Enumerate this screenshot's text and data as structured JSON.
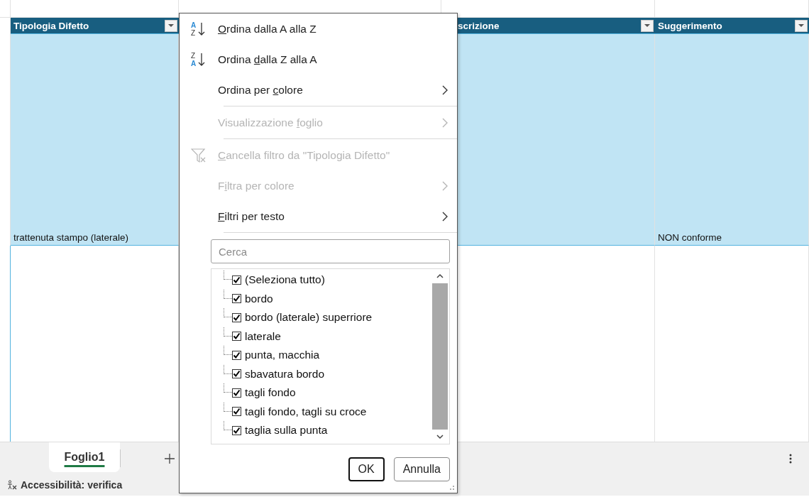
{
  "table": {
    "columns": [
      {
        "label": "Tipologia Difetto",
        "filter": true
      },
      {
        "label": "scrizione",
        "filter": true
      },
      {
        "label": "Suggerimento",
        "filter": true
      }
    ],
    "rows": [
      {
        "tipologia_difetto": "trattenuta stampo (laterale)",
        "suggerimento": "NON conforme",
        "selected": true
      }
    ]
  },
  "sheet_tabs": [
    {
      "label": "Foglio1",
      "selected": true
    }
  ],
  "status_bar": {
    "accessibility": "Accessibilità: verifica"
  },
  "filter_menu": {
    "items": [
      {
        "kind": "sort-az",
        "icon_letters": [
          "A",
          "Z"
        ],
        "label": {
          "key": "O",
          "after": "rdina dalla A alla Z"
        },
        "disabled": false,
        "submenu": false
      },
      {
        "kind": "sort-za",
        "icon_letters": [
          "Z",
          "A"
        ],
        "label": {
          "before": "Ordina ",
          "key": "d",
          "after": "alla Z alla A"
        },
        "disabled": false,
        "submenu": false
      },
      {
        "kind": "plain",
        "label": {
          "before": "Ordina per ",
          "key": "c",
          "after": "olore"
        },
        "disabled": false,
        "submenu": true
      },
      {
        "kind": "separator"
      },
      {
        "kind": "plain",
        "label": {
          "before": "Visualizzazione ",
          "key": "f",
          "after": "oglio"
        },
        "disabled": true,
        "submenu": true
      },
      {
        "kind": "separator"
      },
      {
        "kind": "clear-filter",
        "label": {
          "key": "C",
          "after": "ancella filtro da \"Tipologia Difetto\""
        },
        "disabled": true,
        "submenu": false
      },
      {
        "kind": "plain",
        "label": {
          "before": "F",
          "key": "i",
          "after": "ltra per colore"
        },
        "disabled": true,
        "submenu": true
      },
      {
        "kind": "plain",
        "label": {
          "key": "F",
          "after": "iltri per testo"
        },
        "disabled": false,
        "submenu": true
      },
      {
        "kind": "separator"
      }
    ],
    "search": {
      "placeholder": "Cerca"
    },
    "values": [
      {
        "label": "(Seleziona tutto)",
        "checked": true
      },
      {
        "label": "bordo",
        "checked": true
      },
      {
        "label": "bordo (laterale) superriore",
        "checked": true
      },
      {
        "label": "laterale",
        "checked": true
      },
      {
        "label": "punta, macchia",
        "checked": true
      },
      {
        "label": "sbavatura bordo",
        "checked": true
      },
      {
        "label": "tagli fondo",
        "checked": true
      },
      {
        "label": "tagli fondo, tagli su croce",
        "checked": true
      },
      {
        "label": "taglia sulla punta",
        "checked": true
      }
    ],
    "buttons": [
      {
        "label": "OK",
        "default": true
      },
      {
        "label": "Annulla",
        "default": false
      }
    ]
  }
}
